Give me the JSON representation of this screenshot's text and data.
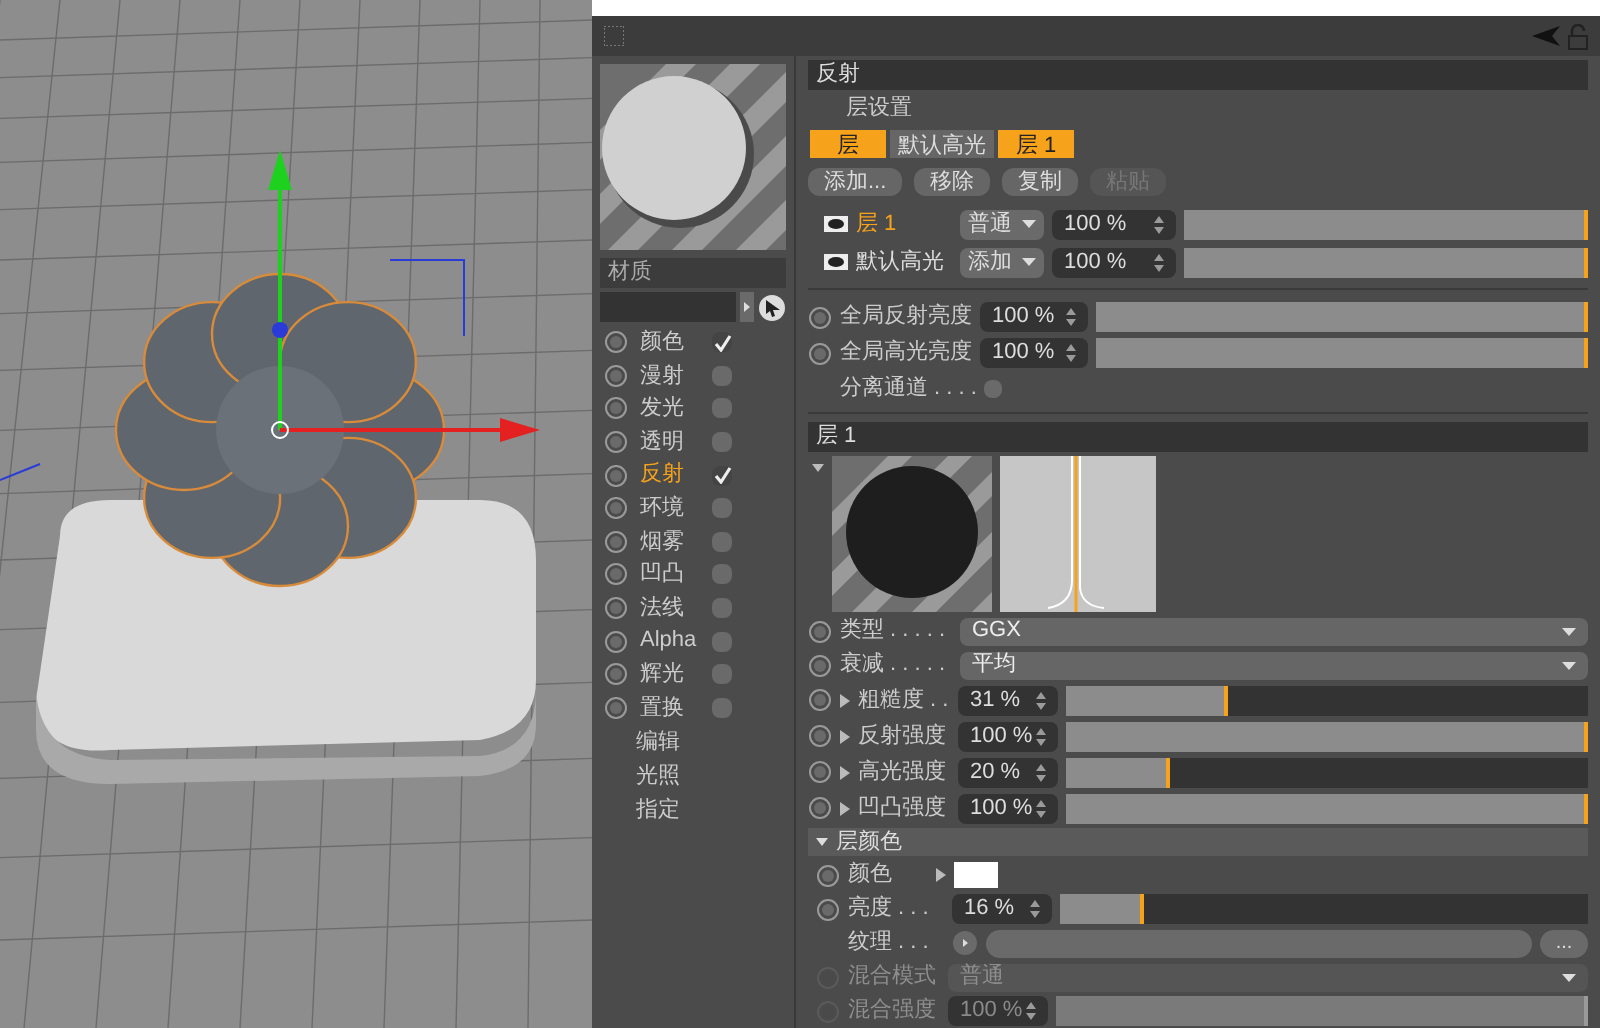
{
  "material": {
    "label": "材质"
  },
  "channels": [
    {
      "label": "颜色",
      "checked": true,
      "selected": false
    },
    {
      "label": "漫射",
      "checked": false,
      "selected": false
    },
    {
      "label": "发光",
      "checked": false,
      "selected": false
    },
    {
      "label": "透明",
      "checked": false,
      "selected": false
    },
    {
      "label": "反射",
      "checked": true,
      "selected": true
    },
    {
      "label": "环境",
      "checked": false,
      "selected": false
    },
    {
      "label": "烟雾",
      "checked": false,
      "selected": false
    },
    {
      "label": "凹凸",
      "checked": false,
      "selected": false
    },
    {
      "label": "法线",
      "checked": false,
      "selected": false
    },
    {
      "label": "Alpha",
      "checked": false,
      "selected": false
    },
    {
      "label": "辉光",
      "checked": false,
      "selected": false
    },
    {
      "label": "置换",
      "checked": false,
      "selected": false
    }
  ],
  "extra_items": [
    "编辑",
    "光照",
    "指定"
  ],
  "reflectance": {
    "title": "反射",
    "settings_label": "层设置",
    "tabs": [
      {
        "label": "层",
        "selected": true
      },
      {
        "label": "默认高光",
        "selected": false
      },
      {
        "label": "层 1",
        "selected": true
      }
    ],
    "buttons": [
      {
        "label": "添加...",
        "disabled": false
      },
      {
        "label": "移除",
        "disabled": false
      },
      {
        "label": "复制",
        "disabled": false
      },
      {
        "label": "粘贴",
        "disabled": true
      }
    ],
    "layers": [
      {
        "name": "层 1",
        "selected": true,
        "mode": "普通",
        "value": "100 %",
        "level": 1
      },
      {
        "name": "默认高光",
        "selected": false,
        "mode": "添加",
        "value": "100 %",
        "level": 1
      }
    ],
    "globals": [
      {
        "label": "全局反射亮度",
        "value": "100 %",
        "level": 1
      },
      {
        "label": "全局高光亮度",
        "value": "100 %",
        "level": 1
      }
    ],
    "separate": {
      "label": "分离通道 . . . .",
      "checked": false
    }
  },
  "layer_panel": {
    "title": "层 1",
    "dropdowns": [
      {
        "label": "类型 . . . . .",
        "value": "GGX"
      },
      {
        "label": "衰减 . . . . .",
        "value": "平均"
      }
    ],
    "sliders": [
      {
        "label": "粗糙度 . .",
        "value": "31 %",
        "level": 0.31
      },
      {
        "label": "反射强度",
        "value": "100 %",
        "level": 1
      },
      {
        "label": "高光强度",
        "value": "20 %",
        "level": 0.2
      },
      {
        "label": "凹凸强度",
        "value": "100 %",
        "level": 1
      }
    ]
  },
  "layer_color": {
    "title": "层颜色",
    "expanded": true,
    "color_label": "颜色",
    "color": "#ffffff",
    "brightness": {
      "label": "亮度 . . .",
      "value": "16 %",
      "level": 0.16
    },
    "texture": {
      "label": "纹理 . . .",
      "more": "..."
    },
    "blend_mode": {
      "label": "混合模式",
      "value": "普通",
      "disabled": true
    },
    "blend_strength": {
      "label": "混合强度",
      "value": "100 %",
      "level": 1,
      "disabled": true
    }
  }
}
